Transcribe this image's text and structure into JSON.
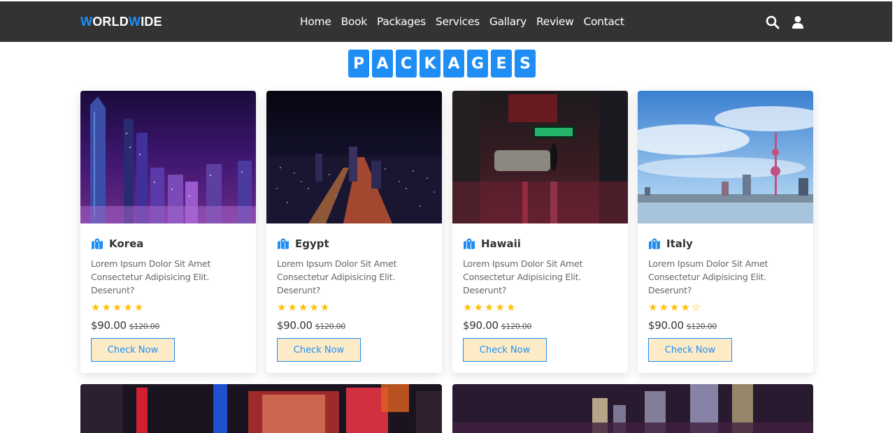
{
  "header": {
    "logo": {
      "part1": "W",
      "part2": "ORLD",
      "part3": "W",
      "part4": "IDE"
    },
    "nav": [
      "Home",
      "Book",
      "Packages",
      "Services",
      "Gallary",
      "Review",
      "Contact"
    ],
    "icons": [
      "search-icon",
      "user-icon"
    ]
  },
  "section": {
    "heading_letters": [
      "P",
      "A",
      "C",
      "K",
      "A",
      "G",
      "E",
      "S"
    ]
  },
  "packages": [
    {
      "name": "Korea",
      "description": "Lorem Ipsum Dolor Sit Amet Consectetur Adipisicing Elit. Deserunt?",
      "rating": 5,
      "price": "$90.00",
      "old_price": "$120.00",
      "button": "Check Now"
    },
    {
      "name": "Egypt",
      "description": "Lorem Ipsum Dolor Sit Amet Consectetur Adipisicing Elit. Deserunt?",
      "rating": 5,
      "price": "$90.00",
      "old_price": "$120.00",
      "button": "Check Now"
    },
    {
      "name": "Hawaii",
      "description": "Lorem Ipsum Dolor Sit Amet Consectetur Adipisicing Elit. Deserunt?",
      "rating": 5,
      "price": "$90.00",
      "old_price": "$120.00",
      "button": "Check Now"
    },
    {
      "name": "Italy",
      "description": "Lorem Ipsum Dolor Sit Amet Consectetur Adipisicing Elit. Deserunt?",
      "rating": 4,
      "price": "$90.00",
      "old_price": "$120.00",
      "button": "Check Now"
    }
  ],
  "colors": {
    "accent": "#1e8ef5",
    "header_bg": "#333333",
    "button_bg": "#fdebc8",
    "star": "#ffc107"
  }
}
